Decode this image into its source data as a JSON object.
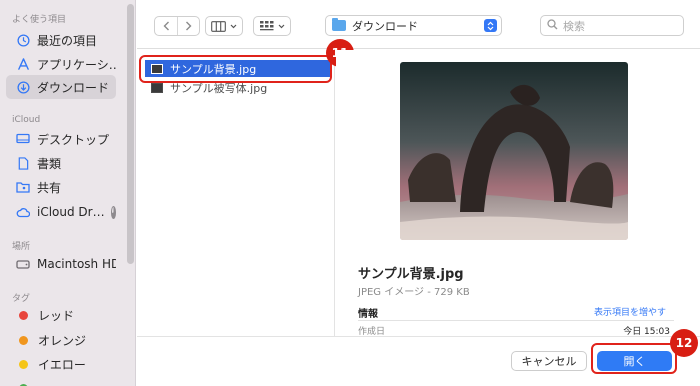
{
  "sidebar": {
    "favorites_header": "よく使う項目",
    "favorites": [
      {
        "label": "最近の項目",
        "icon": "clock-icon"
      },
      {
        "label": "アプリケーシ…",
        "icon": "applications-icon"
      },
      {
        "label": "ダウンロード",
        "icon": "download-icon"
      }
    ],
    "icloud_header": "iCloud",
    "icloud": [
      {
        "label": "デスクトップ",
        "icon": "desktop-icon"
      },
      {
        "label": "書類",
        "icon": "document-icon"
      },
      {
        "label": "共有",
        "icon": "shared-folder-icon"
      },
      {
        "label": "iCloud Dr…",
        "icon": "cloud-icon"
      }
    ],
    "locations_header": "場所",
    "locations": [
      {
        "label": "Macintosh HD",
        "icon": "disk-icon"
      }
    ],
    "tags_header": "タグ",
    "tags": [
      {
        "label": "レッド",
        "color": "#e8453c"
      },
      {
        "label": "オレンジ",
        "color": "#f0961e"
      },
      {
        "label": "イエロー",
        "color": "#f5c518"
      }
    ]
  },
  "toolbar": {
    "location": "ダウンロード",
    "search_placeholder": "検索"
  },
  "files": [
    {
      "name": "サンプル背景.jpg",
      "selected": true
    },
    {
      "name": "サンプル被写体.jpg",
      "selected": false
    }
  ],
  "preview": {
    "title": "サンプル背景.jpg",
    "subtitle": "JPEG イメージ - 729 KB",
    "info_label": "情報",
    "show_more": "表示項目を増やす",
    "created_label": "作成日",
    "created_value": "今日 15:03"
  },
  "buttons": {
    "cancel": "キャンセル",
    "open": "開く"
  },
  "annotations": {
    "step_11": "11",
    "step_12": "12"
  },
  "colors": {
    "accent": "#2f7bf5",
    "annotation_red": "#d81e13"
  }
}
